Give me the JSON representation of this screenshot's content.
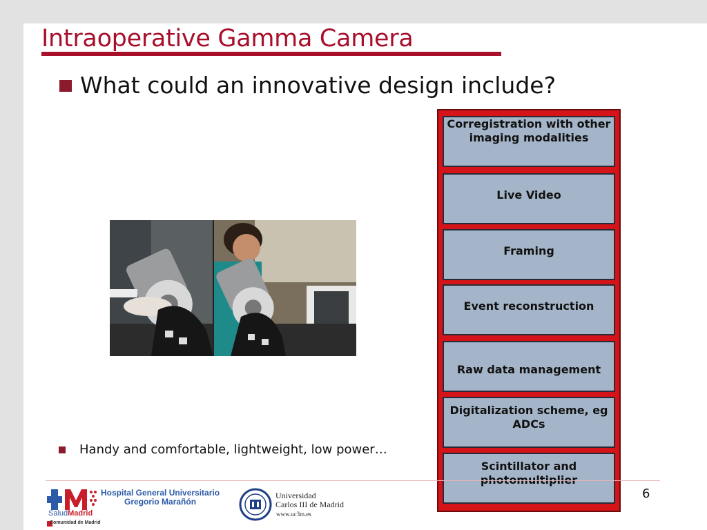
{
  "slide": {
    "title": "Intraoperative Gamma Camera",
    "bullet1": "What could an innovative design include?",
    "bullet2": "Handy and comfortable, lightweight, low power…",
    "page_number": "6"
  },
  "layers": [
    "Corregistration with other imaging modalities",
    "Live Video",
    "Framing",
    "Event reconstruction",
    "Raw data management",
    "Digitalization scheme, eg ADCs",
    "Scintillator and photomultiplier"
  ],
  "footer": {
    "hospital_line1": "Hospital General Universitario",
    "hospital_line2": "Gregorio Marañón",
    "salud_prefix": "Salud",
    "salud_suffix": "Madrid",
    "comunidad": "Comunidad de Madrid",
    "uni_line1": "Universidad",
    "uni_line2": "Carlos III de Madrid",
    "uni_web": "www.uc3m.es"
  },
  "colors": {
    "title": "#a80f2b",
    "stack_frame": "#d41418",
    "layer_fill": "#a5b5c9"
  }
}
